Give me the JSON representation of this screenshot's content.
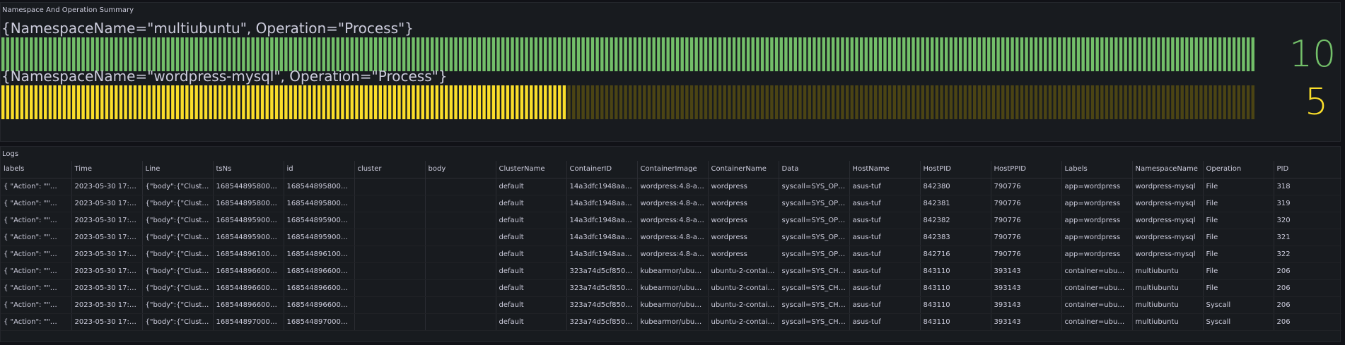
{
  "summary": {
    "title": "Namespace And Operation Summary",
    "gauges": [
      {
        "label": "{NamespaceName=\"multiubuntu\", Operation=\"Process\"}",
        "value": "10",
        "fill_fraction": 1.0,
        "color_on": "#73bf69",
        "color_off": "#2f4a2c",
        "value_color": "#73bf69"
      },
      {
        "label": "{NamespaceName=\"wordpress-mysql\", Operation=\"Process\"}",
        "value": "5",
        "fill_fraction": 0.448,
        "color_on": "#fade2a",
        "color_off": "#4b4414",
        "value_color": "#fade2a"
      }
    ]
  },
  "logs": {
    "title": "Logs",
    "columns": [
      "labels",
      "Time",
      "Line",
      "tsNs",
      "id",
      "cluster",
      "body",
      "ClusterName",
      "ContainerID",
      "ContainerImage",
      "ContainerName",
      "Data",
      "HostName",
      "HostPID",
      "HostPPID",
      "Labels",
      "NamespaceName",
      "Operation",
      "PID"
    ],
    "rows": [
      [
        "{ \"Action\": \"\"…",
        "2023-05-30 17:45…",
        "{\"body\":{\"ClusterN…",
        "16854489580000…",
        "16854489580000…",
        "",
        "",
        "default",
        "14a3dfc1948aad7…",
        "wordpress:4.8-ap…",
        "wordpress",
        "syscall=SYS_OPE…",
        "asus-tuf",
        "842380",
        "790776",
        "app=wordpress",
        "wordpress-mysql",
        "File",
        "318"
      ],
      [
        "{ \"Action\": \"\"…",
        "2023-05-30 17:45…",
        "{\"body\":{\"ClusterN…",
        "16854489580000…",
        "16854489580000…",
        "",
        "",
        "default",
        "14a3dfc1948aad7…",
        "wordpress:4.8-ap…",
        "wordpress",
        "syscall=SYS_OPE…",
        "asus-tuf",
        "842381",
        "790776",
        "app=wordpress",
        "wordpress-mysql",
        "File",
        "319"
      ],
      [
        "{ \"Action\": \"\"…",
        "2023-05-30 17:45…",
        "{\"body\":{\"ClusterN…",
        "16854489590000…",
        "16854489590000…",
        "",
        "",
        "default",
        "14a3dfc1948aad7…",
        "wordpress:4.8-ap…",
        "wordpress",
        "syscall=SYS_OPE…",
        "asus-tuf",
        "842382",
        "790776",
        "app=wordpress",
        "wordpress-mysql",
        "File",
        "320"
      ],
      [
        "{ \"Action\": \"\"…",
        "2023-05-30 17:45…",
        "{\"body\":{\"ClusterN…",
        "16854489590000…",
        "16854489590000…",
        "",
        "",
        "default",
        "14a3dfc1948aad7…",
        "wordpress:4.8-ap…",
        "wordpress",
        "syscall=SYS_OPE…",
        "asus-tuf",
        "842383",
        "790776",
        "app=wordpress",
        "wordpress-mysql",
        "File",
        "321"
      ],
      [
        "{ \"Action\": \"\"…",
        "2023-05-30 17:46…",
        "{\"body\":{\"ClusterN…",
        "16854489610000…",
        "16854489610000…",
        "",
        "",
        "default",
        "14a3dfc1948aad7…",
        "wordpress:4.8-ap…",
        "wordpress",
        "syscall=SYS_OPE…",
        "asus-tuf",
        "842716",
        "790776",
        "app=wordpress",
        "wordpress-mysql",
        "File",
        "322"
      ],
      [
        "{ \"Action\": \"\"…",
        "2023-05-30 17:46…",
        "{\"body\":{\"ClusterN…",
        "16854489660000…",
        "16854489660000…",
        "",
        "",
        "default",
        "323a74d5cf850d…",
        "kubearmor/ubuntu…",
        "ubuntu-2-container",
        "syscall=SYS_CHO…",
        "asus-tuf",
        "843110",
        "393143",
        "container=ubuntu…",
        "multiubuntu",
        "File",
        "206"
      ],
      [
        "{ \"Action\": \"\"…",
        "2023-05-30 17:46…",
        "{\"body\":{\"ClusterN…",
        "16854489660000…",
        "16854489660000…",
        "",
        "",
        "default",
        "323a74d5cf850d…",
        "kubearmor/ubuntu…",
        "ubuntu-2-container",
        "syscall=SYS_CHO…",
        "asus-tuf",
        "843110",
        "393143",
        "container=ubuntu…",
        "multiubuntu",
        "File",
        "206"
      ],
      [
        "{ \"Action\": \"\"…",
        "2023-05-30 17:46…",
        "{\"body\":{\"ClusterN…",
        "16854489660000…",
        "16854489660000…",
        "",
        "",
        "default",
        "323a74d5cf850d…",
        "kubearmor/ubuntu…",
        "ubuntu-2-container",
        "syscall=SYS_CHO…",
        "asus-tuf",
        "843110",
        "393143",
        "container=ubuntu…",
        "multiubuntu",
        "Syscall",
        "206"
      ],
      [
        "{ \"Action\": \"\"…",
        "2023-05-30 17:46…",
        "{\"body\":{\"ClusterN…",
        "16854489700000…",
        "16854489700000…",
        "",
        "",
        "default",
        "323a74d5cf850d…",
        "kubearmor/ubuntu…",
        "ubuntu-2-container",
        "syscall=SYS_CHO…",
        "asus-tuf",
        "843110",
        "393143",
        "container=ubuntu…",
        "multiubuntu",
        "Syscall",
        "206"
      ]
    ]
  }
}
